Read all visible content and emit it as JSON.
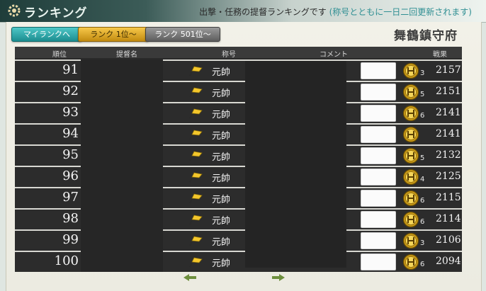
{
  "header": {
    "title": "ランキング",
    "notice_main": "出撃・任務の提督ランキングです",
    "notice_note": "(称号とともに一日二回更新されます)"
  },
  "tabs": {
    "my_rank": "マイランクへ",
    "rank_1": "ランク 1位～",
    "rank_501": "ランク 501位～"
  },
  "base_name": "舞鶴鎮守府",
  "columns": {
    "rank": "順位",
    "admiral": "提督名",
    "title": "称号",
    "comment": "コメント",
    "score": "戦果"
  },
  "rows": [
    {
      "rank": "91",
      "title": "元帥",
      "medals": "3",
      "score": "2157"
    },
    {
      "rank": "92",
      "title": "元帥",
      "medals": "5",
      "score": "2151"
    },
    {
      "rank": "93",
      "title": "元帥",
      "medals": "6",
      "score": "2141"
    },
    {
      "rank": "94",
      "title": "元帥",
      "medals": "",
      "score": "2141"
    },
    {
      "rank": "95",
      "title": "元帥",
      "medals": "5",
      "score": "2132"
    },
    {
      "rank": "96",
      "title": "元帥",
      "medals": "4",
      "score": "2125"
    },
    {
      "rank": "97",
      "title": "元帥",
      "medals": "6",
      "score": "2115"
    },
    {
      "rank": "98",
      "title": "元帥",
      "medals": "6",
      "score": "2114"
    },
    {
      "rank": "99",
      "title": "元帥",
      "medals": "3",
      "score": "2106"
    },
    {
      "rank": "100",
      "title": "元帥",
      "medals": "6",
      "score": "2094"
    }
  ],
  "colors": {
    "tab_my": "#1c8d90",
    "tab_1": "#c28b10",
    "tab_501": "#5d5d5d",
    "accent_note": "#2f8f93"
  },
  "icons": {
    "header": "gear-icon",
    "title": "flag-icon",
    "medal": "medal-icon",
    "pager": "leaf-arrow-icon"
  }
}
